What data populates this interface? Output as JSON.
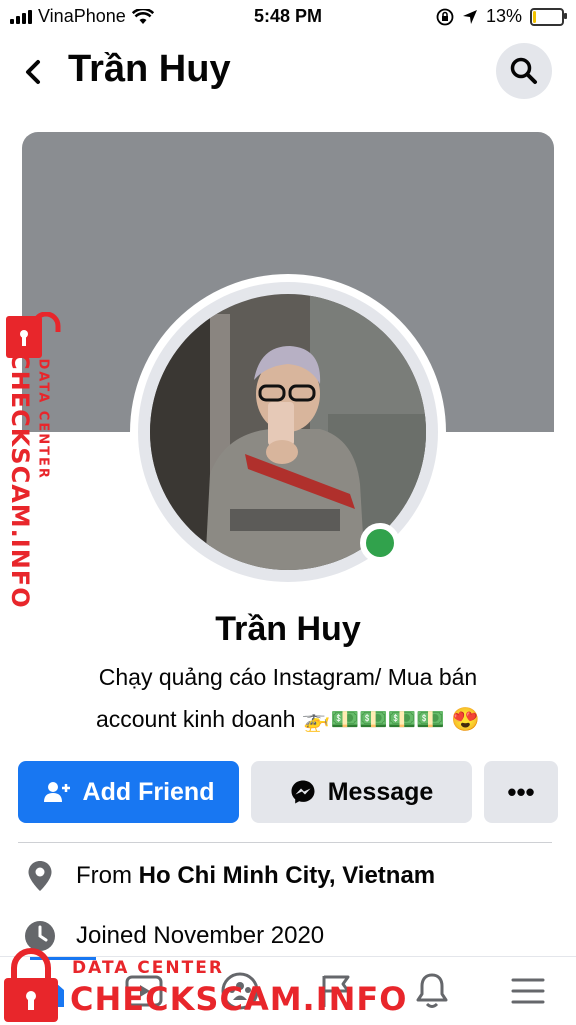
{
  "status_bar": {
    "carrier": "VinaPhone",
    "time": "5:48 PM",
    "battery_percent": "13%",
    "battery_level": 0.13,
    "icons": [
      "signal-icon",
      "wifi-icon",
      "orientation-lock-icon",
      "location-arrow-icon",
      "battery-icon"
    ]
  },
  "header": {
    "title": "Trần Huy",
    "back_icon": "chevron-left-icon",
    "search_icon": "search-icon"
  },
  "profile": {
    "name": "Trần Huy",
    "bio_line1": "Chạy quảng cáo Instagram/ Mua bán",
    "bio_line2": "account kinh doanh 🚁💵💵💵💵 😍",
    "online": true
  },
  "actions": {
    "add_friend": "Add Friend",
    "message": "Message",
    "more": "•••"
  },
  "info": {
    "from_prefix": "From ",
    "from_place": "Ho Chi Minh City, Vietnam",
    "joined": "Joined November 2020"
  },
  "bottom_nav": {
    "items": [
      "home-icon",
      "watch-icon",
      "groups-icon",
      "pages-flag-icon",
      "notifications-bell-icon",
      "menu-icon"
    ]
  },
  "watermark": {
    "small": "DATA CENTER",
    "big": "CHECKSCAM.INFO"
  },
  "colors": {
    "accent": "#1877f2",
    "online": "#31a24c",
    "watermark": "#e8262b",
    "cover": "#8a8d91"
  }
}
